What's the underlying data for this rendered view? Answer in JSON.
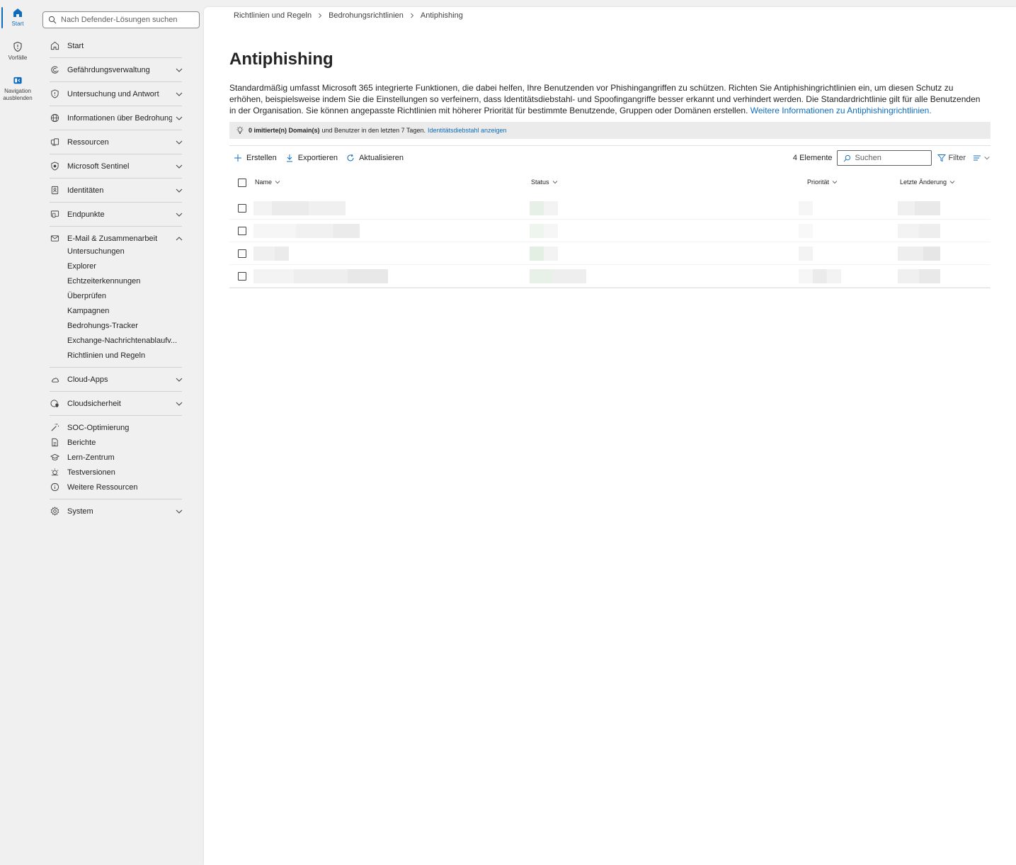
{
  "rail": {
    "items": [
      {
        "label": "Start",
        "icon": "home-icon"
      },
      {
        "label": "Vorfälle",
        "icon": "shield-icon"
      },
      {
        "label": "Navigation ausblenden",
        "icon": "collapse-nav-icon"
      }
    ]
  },
  "sidebar": {
    "search_placeholder": "Nach Defender-Lösungen suchen",
    "items": [
      {
        "label": "Start"
      },
      {
        "label": "Gefährdungsverwaltung"
      },
      {
        "label": "Untersuchung und Antwort"
      },
      {
        "label": "Informationen über Bedrohungen"
      },
      {
        "label": "Ressourcen"
      },
      {
        "label": "Microsoft Sentinel"
      },
      {
        "label": "Identitäten"
      },
      {
        "label": "Endpunkte"
      },
      {
        "label": "E-Mail & Zusammenarbeit"
      }
    ],
    "email_sub": [
      "Untersuchungen",
      "Explorer",
      "Echtzeiterkennungen",
      "Überprüfen",
      "Kampagnen",
      "Bedrohungs-Tracker",
      "Exchange-Nachrichtenablaufv...",
      "Richtlinien und Regeln"
    ],
    "lower": [
      {
        "label": "Cloud-Apps"
      },
      {
        "label": "Cloudsicherheit"
      }
    ],
    "plain": [
      {
        "label": "SOC-Optimierung"
      },
      {
        "label": "Berichte"
      },
      {
        "label": "Lern-Zentrum"
      },
      {
        "label": "Testversionen"
      },
      {
        "label": "Weitere Ressourcen"
      }
    ],
    "system": {
      "label": "System"
    }
  },
  "breadcrumb": [
    "Richtlinien und Regeln",
    "Bedrohungsrichtlinien",
    "Antiphishing"
  ],
  "page": {
    "title": "Antiphishing",
    "description": "Standardmäßig umfasst Microsoft 365 integrierte Funktionen, die dabei helfen, Ihre Benutzenden vor Phishingangriffen zu schützen. Richten Sie Antiphishingrichtlinien ein, um diesen Schutz zu erhöhen, beispielsweise indem Sie die Einstellungen so verfeinern, dass Identitätsdiebstahl- und Spoofingangriffe besser erkannt und verhindert werden. Die Standardrichtlinie gilt für alle Benutzenden in der Organisation. Sie können angepasste Richtlinien mit höherer Priorität für bestimmte Benutzende, Gruppen oder Domänen erstellen. ",
    "description_link": "Weitere Informationen zu Antiphishingrichtlinien."
  },
  "banner": {
    "bold": "0 imitierte(n) Domain(s)",
    "text": "und Benutzer in den letzten 7 Tagen.",
    "link": "Identitätsdiebstahl anzeigen"
  },
  "toolbar": {
    "create": "Erstellen",
    "export": "Exportieren",
    "refresh": "Aktualisieren",
    "count": "4 Elemente",
    "search_placeholder": "Suchen",
    "filter": "Filter"
  },
  "table": {
    "columns": [
      "Name",
      "Status",
      "Priorität",
      "Letzte Änderung"
    ]
  },
  "colors": {
    "accent": "#0f6cbd",
    "background": "#f0f0f0"
  }
}
